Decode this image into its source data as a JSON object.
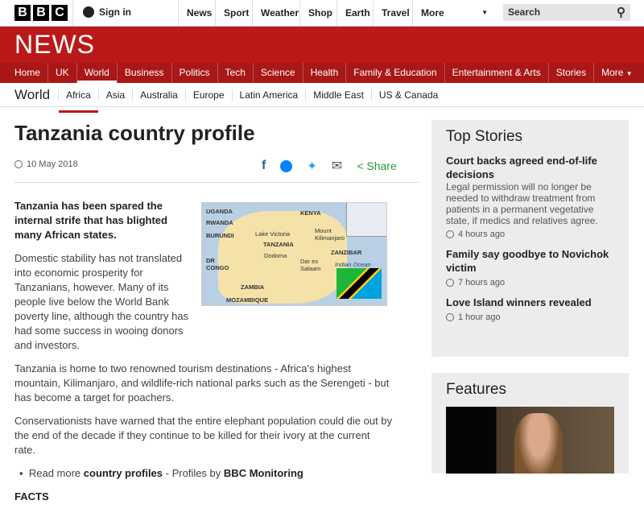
{
  "topbar": {
    "logo": [
      "B",
      "B",
      "C"
    ],
    "sign_in": "Sign in",
    "links": [
      "News",
      "Sport",
      "Weather",
      "Shop",
      "Earth",
      "Travel",
      "More"
    ],
    "search_placeholder": "Search"
  },
  "banner": {
    "title": "NEWS"
  },
  "nav": [
    "Home",
    "UK",
    "World",
    "Business",
    "Politics",
    "Tech",
    "Science",
    "Health",
    "Family & Education",
    "Entertainment & Arts",
    "Stories",
    "More"
  ],
  "subnav": {
    "section": "World",
    "items": [
      "Africa",
      "Asia",
      "Australia",
      "Europe",
      "Latin America",
      "Middle East",
      "US & Canada"
    ]
  },
  "article": {
    "title": "Tanzania country profile",
    "date": "10 May 2018",
    "share_label": "Share",
    "lead": "Tanzania has been spared the internal strife that has blighted many African states.",
    "paragraphs": [
      "Domestic stability has not translated into economic prosperity for Tanzanians, however. Many of its people live below the World Bank poverty line, although the country has had some success in wooing donors and investors.",
      "Tanzania is home to two renowned tourism destinations - Africa's highest mountain, Kilimanjaro, and wildlife-rich national parks such as the Serengeti - but has become a target for poachers.",
      "Conservationists have warned that the entire elephant population could die out by the end of the decade if they continue to be killed for their ivory at the current rate."
    ],
    "read_more": {
      "prefix": "Read more",
      "link1": "country profiles",
      "middle": "- Profiles by",
      "link2": "BBC Monitoring"
    },
    "facts_heading": "FACTS",
    "map_labels": {
      "uganda": "UGANDA",
      "rwanda": "RWANDA",
      "burundi": "BURUNDI",
      "kenya": "KENYA",
      "lake": "Lake Victoria",
      "mount": "Mount Kilimanjaro",
      "tanzania": "TANZANIA",
      "dodoma": "Dodoma",
      "dar": "Dar es Salaam",
      "zanzibar": "ZANZIBAR",
      "ocean": "Indian Ocean",
      "drc": "DR CONGO",
      "zambia": "ZAMBIA",
      "mozambique": "MOZAMBIQUE"
    }
  },
  "top_stories": {
    "heading": "Top Stories",
    "items": [
      {
        "title": "Court backs agreed end-of-life decisions",
        "summary": "Legal permission will no longer be needed to withdraw treatment from patients in a permanent vegetative state, if medics and relatives agree.",
        "age": "4 hours ago"
      },
      {
        "title": "Family say goodbye to Novichok victim",
        "age": "7 hours ago"
      },
      {
        "title": "Love Island winners revealed",
        "age": "1 hour ago"
      }
    ]
  },
  "features": {
    "heading": "Features"
  },
  "colors": {
    "brand_red": "#bb1919",
    "nav_red": "#a91717",
    "share_green": "#2b9a3a"
  }
}
